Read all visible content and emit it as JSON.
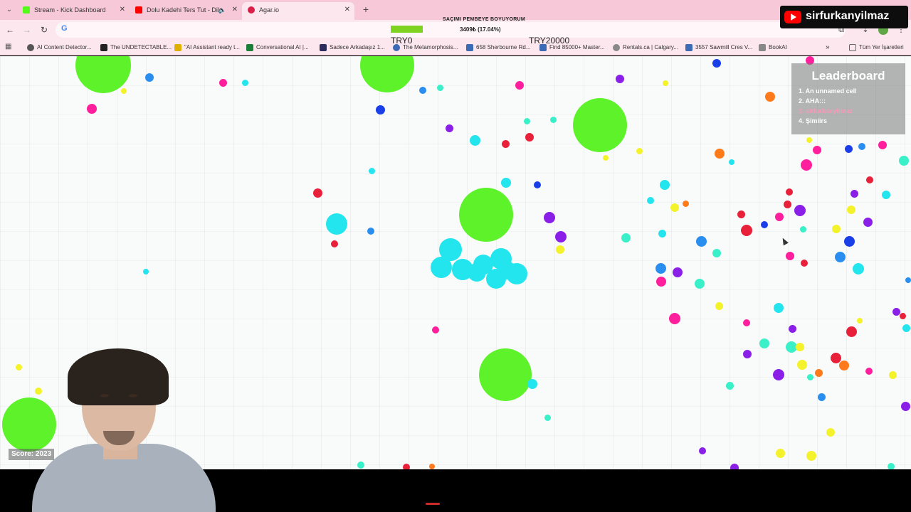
{
  "browser": {
    "tabs": [
      {
        "title": "Stream - Kick Dashboard",
        "favicon_color": "#53fc18"
      },
      {
        "title": "Dolu Kadehi Ters Tut - Dile",
        "favicon_color": "#ff0000"
      },
      {
        "title": "Agar.io",
        "favicon_color": "#d9204a"
      }
    ],
    "bookmarks": [
      {
        "label": "AI Content Detector...",
        "color": "#555555"
      },
      {
        "label": "The UNDETECTABLE...",
        "color": "#222222"
      },
      {
        "label": "\"AI Assistant ready t...",
        "color": "#e0b000"
      },
      {
        "label": "Conversational AI |...",
        "color": "#1a7f37"
      },
      {
        "label": "Sadece Arkadaşız 1...",
        "color": "#2b2b5c"
      },
      {
        "label": "The Metamorphosis...",
        "color": "#3b6bb5"
      },
      {
        "label": "658 Sherbourne Rd...",
        "color": "#3b6bb5"
      },
      {
        "label": "Find 85000+ Master...",
        "color": "#3b6bb5"
      },
      {
        "label": "Rentals.ca | Calgary...",
        "color": "#888888"
      },
      {
        "label": "3557 Sawmill Cres V...",
        "color": "#3b6bb5"
      },
      {
        "label": "BookAI",
        "color": "#888888"
      }
    ],
    "all_bookmarks": "Tüm Yer İşaretleri"
  },
  "stream": {
    "channel": "sirfurkanyilmaz",
    "viewer_title": "SAÇIMI PEMBEYE BOYUYORUM",
    "progress_text": "3409₺ (17.04%)",
    "progress_fraction": 0.1704,
    "goal_start": "TRY0",
    "goal_end": "TRY20000"
  },
  "game": {
    "leaderboard_title": "Leaderboard",
    "leaderboard": [
      "1. An unnamed cell",
      "2. AHA:::",
      "3. sirfurkanyilmaz",
      "4. Şimiirs"
    ],
    "leaderboard_self_index": 2,
    "score": "Score: 2023",
    "player_color": "#22e5ee"
  }
}
